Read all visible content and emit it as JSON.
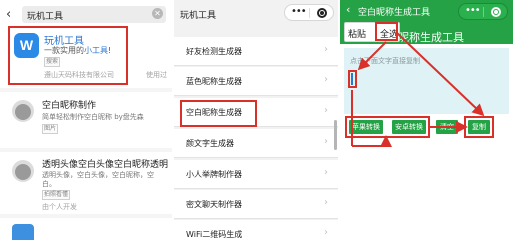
{
  "search_panel": {
    "back_icon": "chevron-left-icon",
    "query": "玩机工具",
    "clear_icon": "clear-circle-icon",
    "top_result": {
      "logo_letter": "W",
      "name": "玩机工具",
      "desc_prefix": "一款实用的",
      "desc_highlight": "小工具",
      "desc_suffix": "!",
      "tag": "搜索",
      "company": "遵山天码科技有限公司",
      "used": "使用过"
    },
    "results": [
      {
        "name": "空白昵称制作",
        "desc": "简单轻松制作空白昵称 by盘先森",
        "tag": "图片",
        "owner": ""
      },
      {
        "name": "透明头像空白头像空白昵称透明",
        "desc": "透明头像，空白头像，空白昵称，空",
        "desc2": "白。",
        "tag": "拍照看懂",
        "owner": "由个人开发"
      },
      {
        "name": "",
        "desc": "",
        "tag": "",
        "owner": ""
      }
    ]
  },
  "list_panel": {
    "title": "玩机工具",
    "more_icon": "more-dots-icon",
    "close_icon": "target-icon",
    "items": [
      "好友检测生成器",
      "蓝色昵称生成器",
      "空白昵称生成器",
      "颜文字生成器",
      "小人举牌制作器",
      "密文聊天制作器",
      "WiFi二维码生成"
    ],
    "chevron_icon": "chevron-right-icon"
  },
  "tool_panel": {
    "title": "空白昵称生成工具",
    "back_icon": "chevron-left-icon",
    "tool_title": "昵称生成工具",
    "popup": {
      "paste": "粘贴",
      "select_all": "全选"
    },
    "placeholder": "点击下面文字直接复制",
    "buttons": {
      "apple": "苹果转换",
      "android": "安卓转换",
      "clear": "清空",
      "copy": "复制"
    }
  },
  "colors": {
    "accent_green": "#25a245",
    "highlight_red": "#d9302a",
    "link_blue": "#2a76d2"
  }
}
